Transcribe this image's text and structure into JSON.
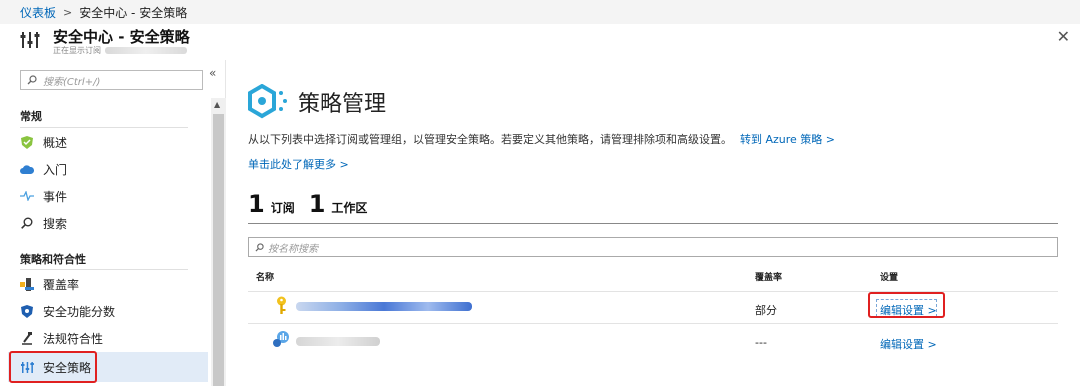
{
  "breadcrumb": {
    "home": "仪表板",
    "separator": ">",
    "current": "安全中心 - 安全策略"
  },
  "header": {
    "title": "安全中心 - 安全策略",
    "subtitle": "正在显示订阅",
    "close_glyph": "✕"
  },
  "sidebar": {
    "search_placeholder": "搜索(Ctrl+/)",
    "collapse_glyph": "«",
    "groups": [
      {
        "label": "常规",
        "items": [
          {
            "label": "概述",
            "icon": "shield-check-icon"
          },
          {
            "label": "入门",
            "icon": "cloud-icon"
          },
          {
            "label": "事件",
            "icon": "activity-icon"
          },
          {
            "label": "搜索",
            "icon": "search-icon"
          }
        ]
      },
      {
        "label": "策略和符合性",
        "items": [
          {
            "label": "覆盖率",
            "icon": "coverage-icon"
          },
          {
            "label": "安全功能分数",
            "icon": "shield-score-icon"
          },
          {
            "label": "法规符合性",
            "icon": "compliance-icon"
          },
          {
            "label": "安全策略",
            "icon": "policy-sliders-icon",
            "active": true
          }
        ]
      }
    ]
  },
  "main": {
    "title": "策略管理",
    "description": "从以下列表中选择订阅或管理组，以管理安全策略。若要定义其他策略，请管理排除项和高级设置。",
    "azure_link": "转到 Azure 策略 >",
    "learn_more": "单击此处了解更多 >",
    "stats": [
      {
        "count": "1",
        "label": "订阅"
      },
      {
        "count": "1",
        "label": "工作区"
      }
    ],
    "filter_placeholder": "按名称搜索",
    "table": {
      "headers": {
        "name": "名称",
        "coverage": "覆盖率",
        "settings": "设置"
      },
      "rows": [
        {
          "icon": "key-icon",
          "coverage": "部分",
          "settings": "编辑设置 >"
        },
        {
          "icon": "workspace-icon",
          "coverage": "---",
          "settings": "编辑设置 >"
        }
      ]
    }
  },
  "colors": {
    "accent": "#0067b8",
    "highlight": "#e02020",
    "active_bg": "#e1ebf7"
  }
}
